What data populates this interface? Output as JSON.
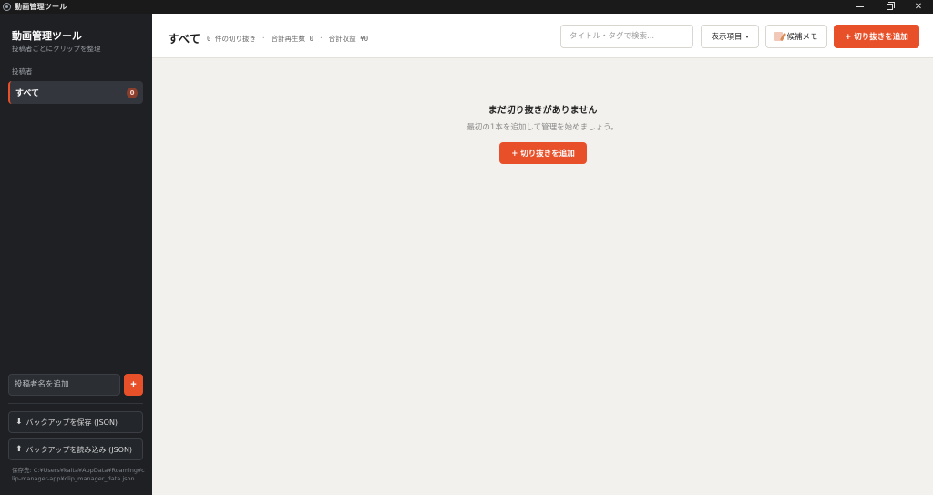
{
  "window": {
    "title": "動画管理ツール"
  },
  "sidebar": {
    "app_title": "動画管理ツール",
    "subtitle": "投稿者ごとにクリップを整理",
    "section_label": "投稿者",
    "items": [
      {
        "label": "すべて",
        "count": "0",
        "selected": true
      }
    ],
    "add_creator": {
      "placeholder": "投稿者名を追加",
      "button": "+"
    },
    "backup_save_label": "バックアップを保存 (JSON)",
    "backup_load_label": "バックアップを読み込み (JSON)",
    "save_path": "保存先: C:¥Users¥kaita¥AppData¥Roaming¥clip-manager-app¥clip_manager_data.json"
  },
  "header": {
    "title": "すべて",
    "stats": {
      "clips": "0 件の切り抜き",
      "sep1": "·",
      "views": "合計再生数 0",
      "sep2": "·",
      "revenue": "合計収益 ¥0"
    },
    "search_placeholder": "タイトル・タグで検索...",
    "columns_label": "表示項目",
    "columns_caret": "▾",
    "memo_label": "候補メモ",
    "add_label": "+ 切り抜きを追加"
  },
  "empty_state": {
    "title": "まだ切り抜きがありません",
    "subtitle": "最初の1本を追加して管理を始めましょう。",
    "add_label": "+ 切り抜きを追加"
  },
  "colors": {
    "accent": "#e8502a",
    "sidebar_bg": "#1e2024",
    "content_bg": "#f3f1ed"
  }
}
